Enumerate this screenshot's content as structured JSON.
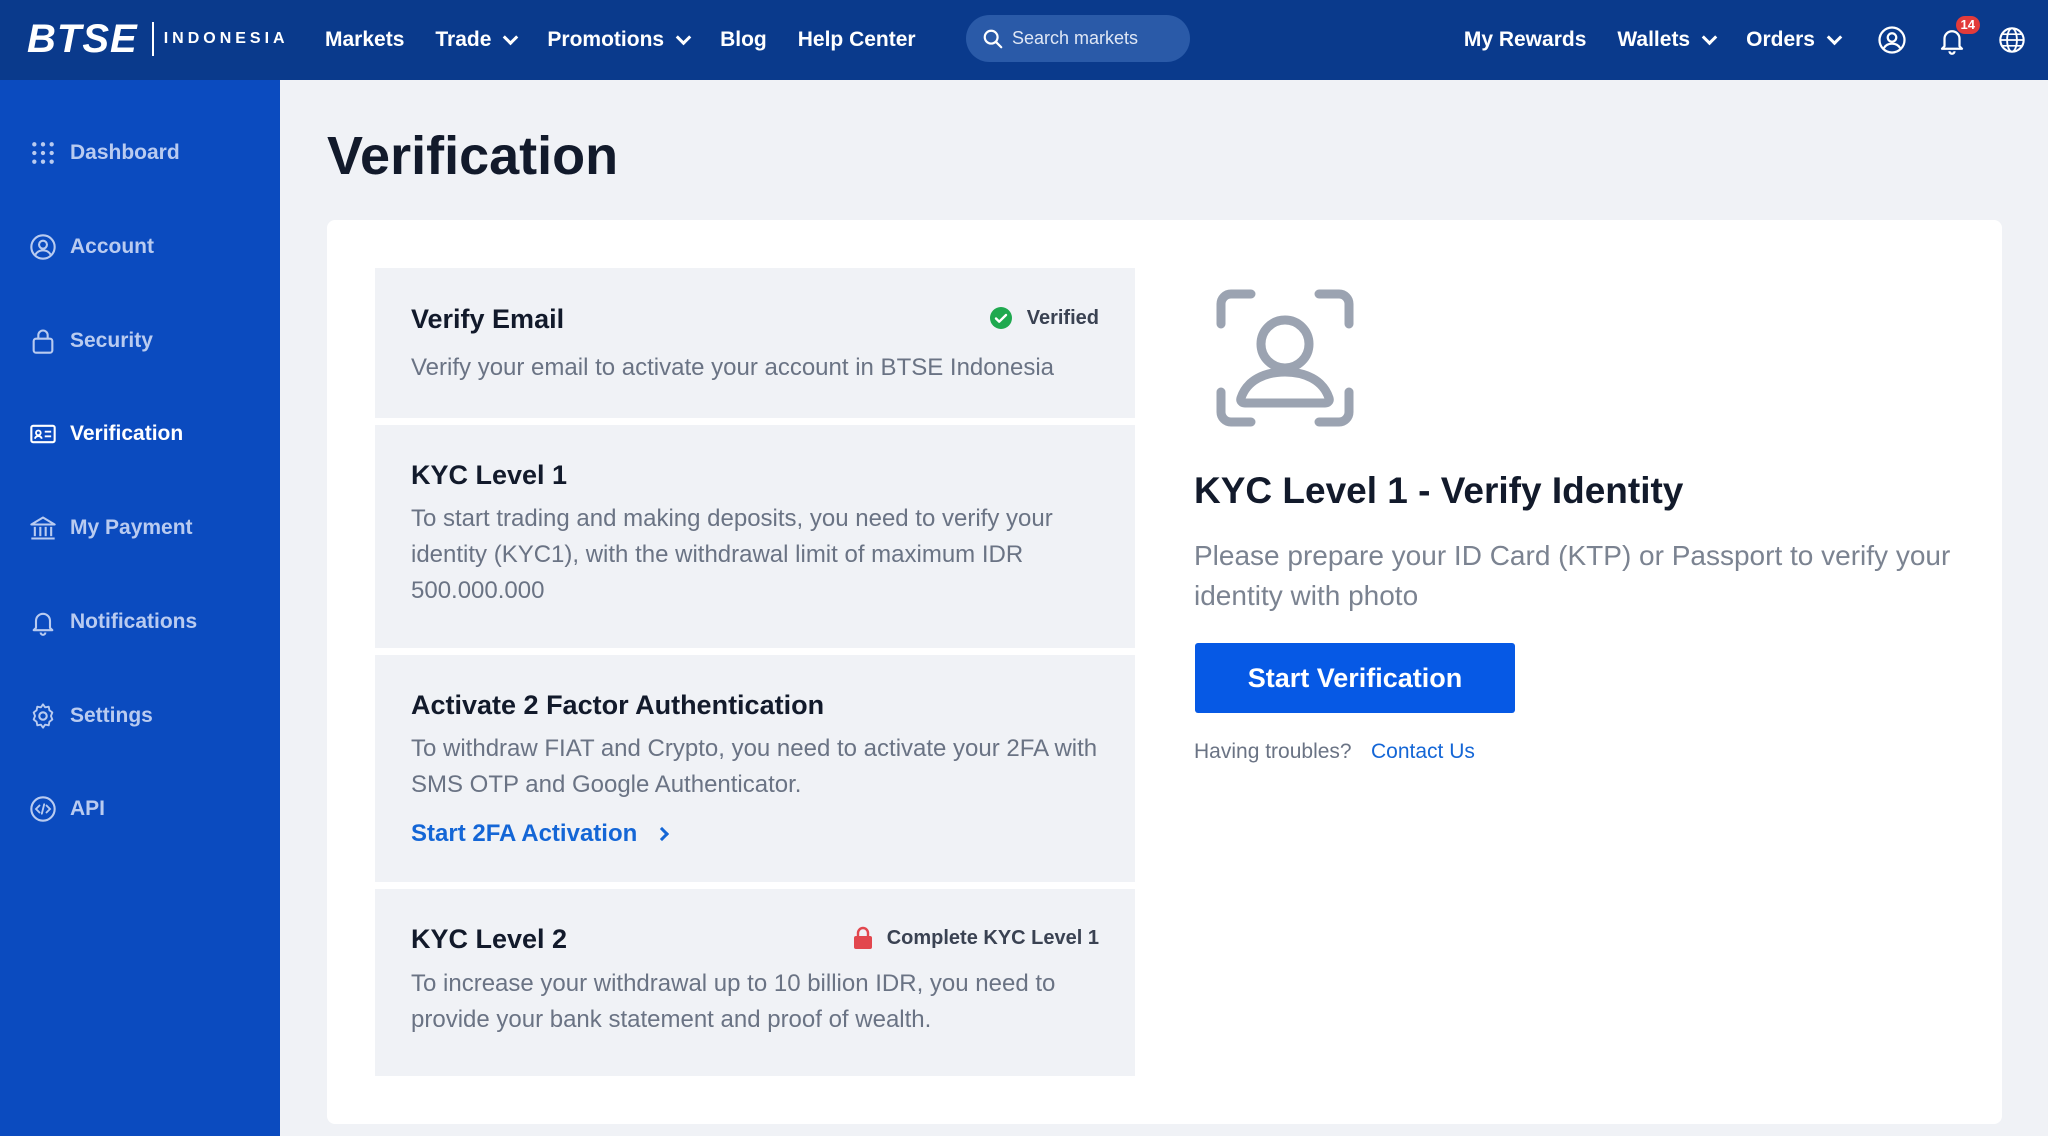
{
  "brand": {
    "name": "BTSE",
    "region": "INDONESIA"
  },
  "nav": {
    "items": [
      {
        "label": "Markets"
      },
      {
        "label": "Trade"
      },
      {
        "label": "Promotions"
      },
      {
        "label": "Blog"
      },
      {
        "label": "Help Center"
      }
    ],
    "search_placeholder": "Search markets",
    "right": [
      {
        "label": "My Rewards"
      },
      {
        "label": "Wallets"
      },
      {
        "label": "Orders"
      }
    ],
    "notification_count": "14"
  },
  "sidebar": {
    "items": [
      {
        "label": "Dashboard",
        "icon": "grid-icon"
      },
      {
        "label": "Account",
        "icon": "user-circle-icon"
      },
      {
        "label": "Security",
        "icon": "lock-icon"
      },
      {
        "label": "Verification",
        "icon": "id-card-icon",
        "active": true
      },
      {
        "label": "My Payment",
        "icon": "bank-icon"
      },
      {
        "label": "Notifications",
        "icon": "bell-icon"
      },
      {
        "label": "Settings",
        "icon": "gear-icon"
      },
      {
        "label": "API",
        "icon": "code-icon"
      }
    ]
  },
  "page": {
    "title": "Verification"
  },
  "steps": [
    {
      "title": "Verify Email",
      "status": "Verified",
      "description": "Verify your email to activate your account in BTSE Indonesia"
    },
    {
      "title": "KYC Level 1",
      "description": "To start trading and making deposits, you need to verify your identity (KYC1), with the withdrawal limit of maximum IDR 500.000.000"
    },
    {
      "title": "Activate 2 Factor Authentication",
      "description": "To withdraw FIAT and Crypto, you need to activate your 2FA with SMS OTP and Google Authenticator.",
      "link": "Start 2FA Activation"
    },
    {
      "title": "KYC Level 2",
      "status": "Complete KYC Level 1",
      "description": "To increase your withdrawal up to 10 billion IDR, you need to provide your bank statement and proof of wealth."
    }
  ],
  "kyc": {
    "title": "KYC Level 1 - Verify Identity",
    "description": "Please prepare your ID Card (KTP) or Passport to verify your identity with photo",
    "button": "Start Verification",
    "trouble_text": "Having troubles?",
    "contact_link": "Contact Us"
  },
  "colors": {
    "nav_bg": "#0a3a8c",
    "sidebar_bg": "#0b4bbf",
    "accent": "#0659e5",
    "verified": "#1fa94f",
    "locked": "#e2474e"
  }
}
